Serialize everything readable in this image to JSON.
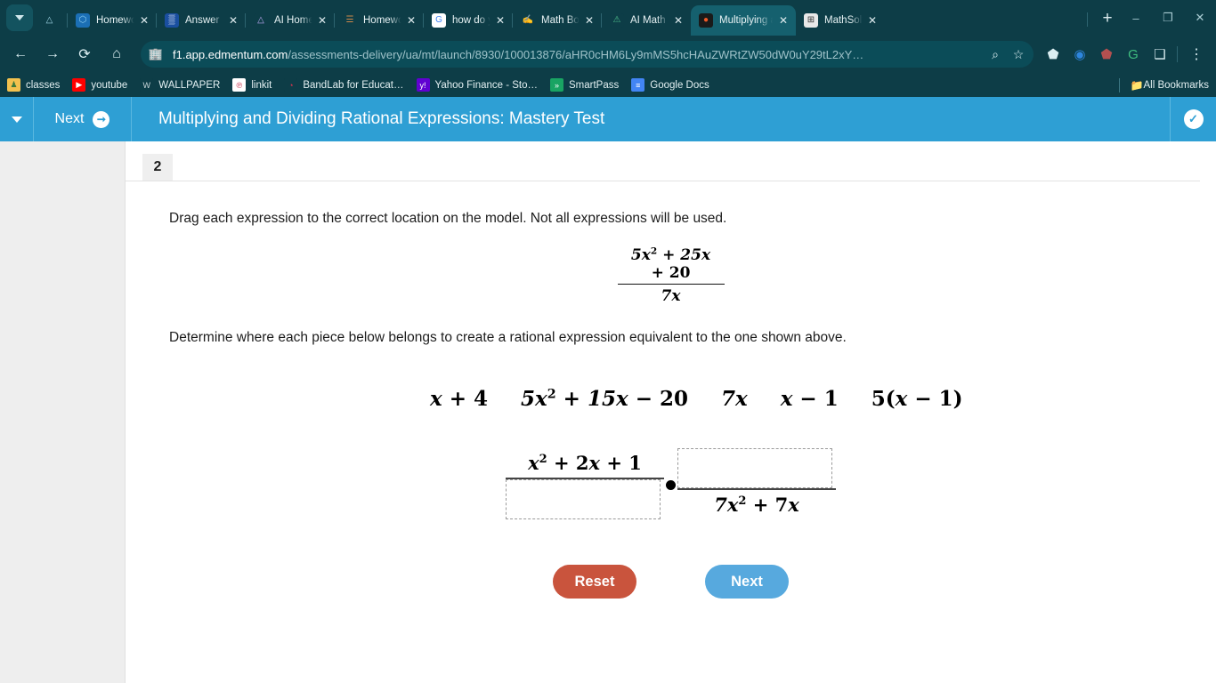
{
  "browser": {
    "tab_search_icon": "chevron-down-icon",
    "tabs": [
      {
        "title": "Homework Help",
        "favicon": "copilot-icon",
        "fav_bg": "#1b6fb5",
        "fav_fg": "#8fd0f0",
        "fav_char": "⬡",
        "active": false
      },
      {
        "title": "Answer - Sma",
        "favicon": "brainly-icon",
        "fav_bg": "#1a4fa0",
        "fav_fg": "#ffffff",
        "fav_char": "▒",
        "active": false
      },
      {
        "title": "AI Homework",
        "favicon": "triangle-icon",
        "fav_bg": "#0d3d47",
        "fav_fg": "#b9a6ef",
        "fav_char": "△",
        "active": false
      },
      {
        "title": "Homework He",
        "favicon": "bench-icon",
        "fav_bg": "#0d3d47",
        "fav_fg": "#d08a4a",
        "fav_char": "☰",
        "active": false
      },
      {
        "title": "how do you s",
        "favicon": "google-icon",
        "fav_bg": "#ffffff",
        "fav_fg": "#4285f4",
        "fav_char": "G",
        "active": false
      },
      {
        "title": "Math Bot - AI",
        "favicon": "mathbot-icon",
        "fav_bg": "#0d3d47",
        "fav_fg": "#cfe7ec",
        "fav_char": "✍",
        "active": false
      },
      {
        "title": "AI Math Calc",
        "favicon": "compass-icon",
        "fav_bg": "#0d3d47",
        "fav_fg": "#4fbf8b",
        "fav_char": "⚠",
        "active": false
      },
      {
        "title": "Multiplying a",
        "favicon": "edmentum-icon",
        "fav_bg": "#1a1a1a",
        "fav_fg": "#f05a28",
        "fav_char": "●",
        "active": true
      },
      {
        "title": "MathSolver",
        "favicon": "mathsolver-icon",
        "fav_bg": "#e8e8e8",
        "fav_fg": "#333333",
        "fav_char": "⊞",
        "active": false
      }
    ],
    "new_tab_label": "+",
    "window_minimize": "–",
    "window_maximize": "❐",
    "window_close": "✕",
    "nav": {
      "back": "←",
      "forward": "→",
      "reload": "⟳",
      "home": "⌂"
    },
    "omnibox": {
      "site_icon": "building-icon",
      "url_domain": "f1.app.edmentum.com",
      "url_path": "/assessments-delivery/ua/mt/launch/8930/100013876/aHR0cHM6Ly9mMS5hcHAuZWRtZW50dW0uY29tL2xY…",
      "zoom_icon": "⌕",
      "bookmark_icon": "☆"
    },
    "extensions": [
      {
        "name": "shield-extension-icon",
        "glyph": "⬟",
        "color": "#dbeef2"
      },
      {
        "name": "privacy-badger-icon",
        "glyph": "◉",
        "color": "#2e86de"
      },
      {
        "name": "adblock-icon",
        "glyph": "⬟",
        "color": "#b35050"
      },
      {
        "name": "grammarly-icon",
        "glyph": "G",
        "color": "#3fbf7f"
      },
      {
        "name": "extensions-puzzle-icon",
        "glyph": "❑",
        "color": "#dbeef2"
      }
    ],
    "menu_icon": "⋮",
    "bookmarks": [
      {
        "label": "classes",
        "icon_bg": "#f2c14e",
        "icon_fg": "#3c7a3c",
        "glyph": "♟"
      },
      {
        "label": "youtube",
        "icon_bg": "#ff0000",
        "icon_fg": "#ffffff",
        "glyph": "▶"
      },
      {
        "label": "WALLPAPER",
        "icon_bg": "#0d3d47",
        "icon_fg": "#c9d7da",
        "glyph": "W"
      },
      {
        "label": "linkit",
        "icon_bg": "#ffffff",
        "icon_fg": "#c4314b",
        "glyph": "℗"
      },
      {
        "label": "BandLab for Educat…",
        "icon_bg": "#0d3d47",
        "icon_fg": "#e8324f",
        "glyph": "◔"
      },
      {
        "label": "Yahoo Finance - Sto…",
        "icon_bg": "#6001d2",
        "icon_fg": "#ffffff",
        "glyph": "y!"
      },
      {
        "label": "SmartPass",
        "icon_bg": "#19a463",
        "icon_fg": "#ffffff",
        "glyph": "»"
      },
      {
        "label": "Google Docs",
        "icon_bg": "#4285f4",
        "icon_fg": "#ffffff",
        "glyph": "≡"
      }
    ],
    "all_bookmarks_label": "All Bookmarks",
    "all_bookmarks_icon": "folder-icon"
  },
  "app": {
    "header": {
      "menu_chevron": "chevron-down-icon",
      "next_label": "Next",
      "next_arrow": "➜",
      "title": "Multiplying and Dividing Rational Expressions: Mastery Test",
      "submit_check": "✓"
    },
    "question": {
      "number": "2",
      "instruction": "Drag each expression to the correct location on the model. Not all expressions will be used.",
      "sub_instruction": "Determine where each piece below belongs to create a rational expression equivalent to the one shown above.",
      "target_fraction": {
        "numerator": "5x2 + 25x + 20",
        "denominator": "7x"
      },
      "draggable_options": [
        "x + 4",
        "5x2 + 15x − 20",
        "7x",
        "x − 1",
        "5(x − 1)"
      ],
      "model": {
        "left_fraction": {
          "numerator": "x2 + 2x + 1",
          "denominator": ""
        },
        "operator": "·",
        "right_fraction": {
          "numerator": "",
          "denominator": "7x2 + 7x"
        }
      },
      "buttons": {
        "reset": "Reset",
        "next": "Next"
      }
    }
  },
  "colors": {
    "browser_chrome": "#0d3d47",
    "active_tab": "#15606e",
    "app_header": "#2e9fd4",
    "reset_button": "#c9543d",
    "next_button": "#57a9de"
  }
}
